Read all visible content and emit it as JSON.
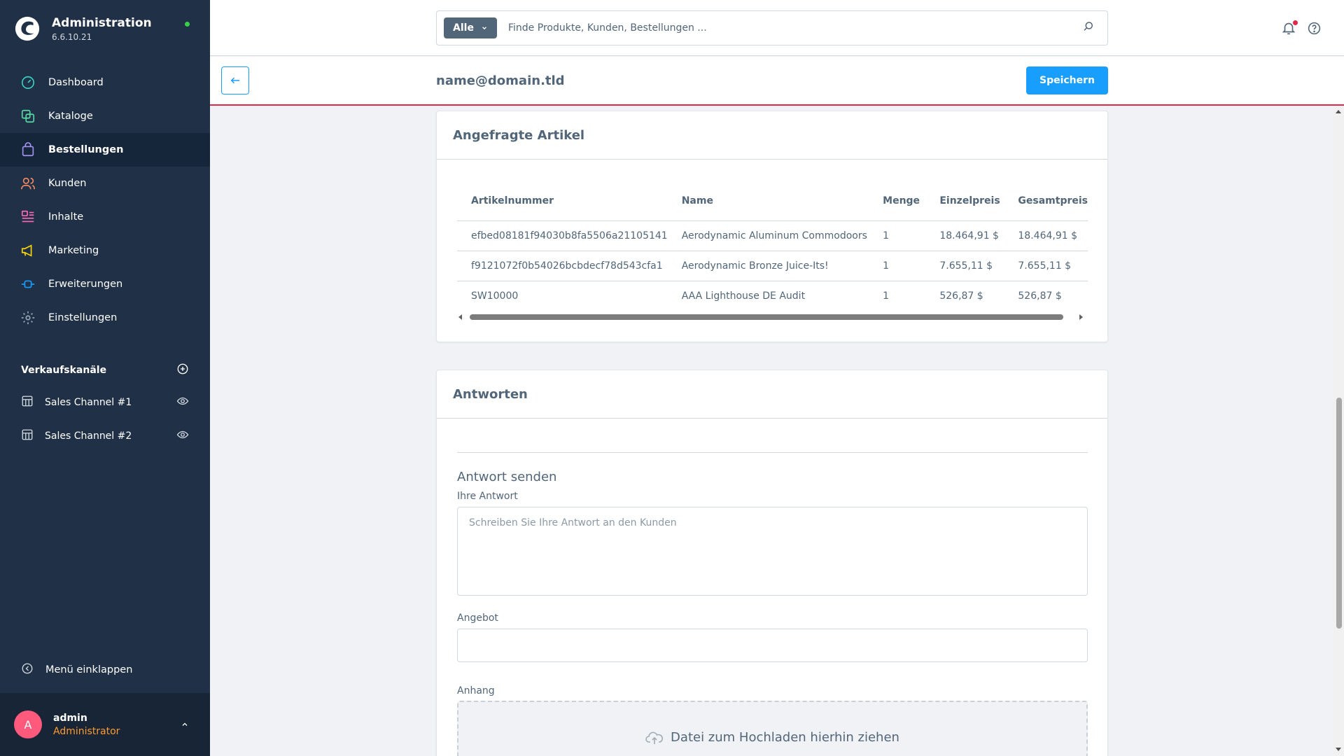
{
  "app": {
    "title": "Administration",
    "version": "6.6.10.21"
  },
  "nav": {
    "items": [
      {
        "label": "Dashboard",
        "icon": "gauge-icon",
        "color": "#37d1c2"
      },
      {
        "label": "Kataloge",
        "icon": "catalog-icon",
        "color": "#57d9a3"
      },
      {
        "label": "Bestellungen",
        "icon": "shopping-bag-icon",
        "color": "#a092f0",
        "active": true
      },
      {
        "label": "Kunden",
        "icon": "users-icon",
        "color": "#f88962"
      },
      {
        "label": "Inhalte",
        "icon": "content-icon",
        "color": "#ff68b4"
      },
      {
        "label": "Marketing",
        "icon": "megaphone-icon",
        "color": "#ffd700"
      },
      {
        "label": "Erweiterungen",
        "icon": "plug-icon",
        "color": "#189eff"
      },
      {
        "label": "Einstellungen",
        "icon": "gear-icon",
        "color": "#9aa8b5"
      }
    ]
  },
  "sales_channels": {
    "heading": "Verkaufskanäle",
    "items": [
      {
        "label": "Sales Channel #1"
      },
      {
        "label": "Sales Channel #2"
      }
    ]
  },
  "sidebar": {
    "collapse_label": "Menü einklappen"
  },
  "user": {
    "initial": "A",
    "name": "admin",
    "role": "Administrator"
  },
  "search": {
    "type_label": "Alle",
    "placeholder": "Finde Produkte, Kunden, Bestellungen ..."
  },
  "smartbar": {
    "title": "name@domain.tld",
    "save_label": "Speichern"
  },
  "requested_items": {
    "title": "Angefragte Artikel",
    "columns": [
      "Artikelnummer",
      "Name",
      "Menge",
      "Einzelpreis",
      "Gesamtpreis"
    ],
    "rows": [
      [
        "efbed08181f94030b8fa5506a21105141",
        "Aerodynamic Aluminum Commodoors",
        "1",
        "18.464,91 $",
        "18.464,91 $"
      ],
      [
        "f9121072f0b54026bcbdecf78d543cfa1",
        "Aerodynamic Bronze Juice-Its!",
        "1",
        "7.655,11 $",
        "7.655,11 $"
      ],
      [
        "SW10000",
        "AAA Lighthouse DE Audit",
        "1",
        "526,87 $",
        "526,87 $"
      ]
    ]
  },
  "answers": {
    "title": "Antworten",
    "reply_title": "Antwort senden",
    "reply_label": "Ihre Antwort",
    "reply_placeholder": "Schreiben Sie Ihre Antwort an den Kunden",
    "offer_label": "Angebot",
    "offer_value": "",
    "attachment_label": "Anhang",
    "dropzone_label": "Datei zum Hochladen hierhin ziehen"
  },
  "colors": {
    "sidebar_bg": "#1f3047",
    "primary": "#189eff",
    "accent_red": "#de294c"
  }
}
